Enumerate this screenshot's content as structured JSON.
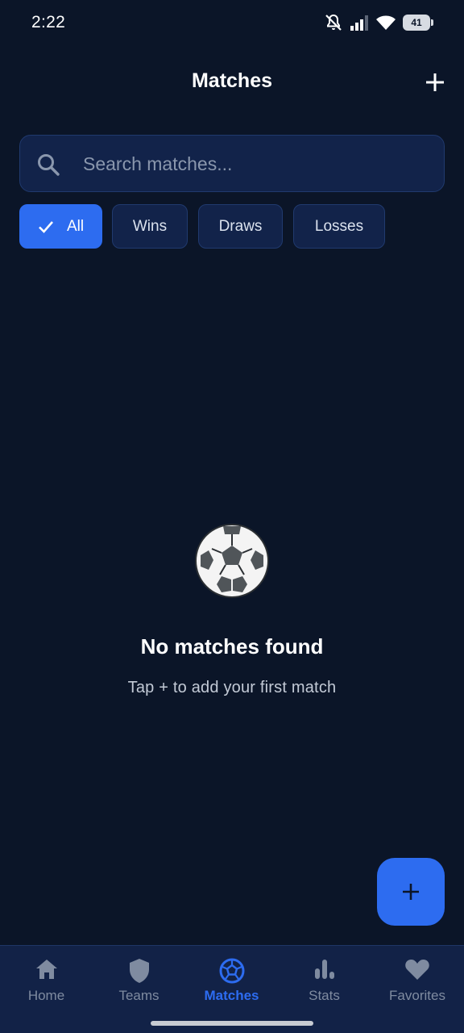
{
  "status_bar": {
    "time": "2:22",
    "battery_level": "41",
    "icons": [
      "notifications-off-icon",
      "signal-icon",
      "wifi-icon",
      "battery-icon"
    ]
  },
  "app_bar": {
    "title": "Matches",
    "action_icon": "plus-icon"
  },
  "search": {
    "placeholder": "Search matches...",
    "value": ""
  },
  "filters": [
    {
      "label": "All",
      "selected": true,
      "icon": "check-icon"
    },
    {
      "label": "Wins",
      "selected": false
    },
    {
      "label": "Draws",
      "selected": false
    },
    {
      "label": "Losses",
      "selected": false
    }
  ],
  "empty_state": {
    "icon": "soccer-ball-icon",
    "title": "No matches found",
    "subtitle": "Tap + to add your first match"
  },
  "fab": {
    "icon": "plus-icon"
  },
  "bottom_nav": {
    "items": [
      {
        "label": "Home",
        "icon": "home-icon",
        "active": false
      },
      {
        "label": "Teams",
        "icon": "shield-icon",
        "active": false
      },
      {
        "label": "Matches",
        "icon": "soccer-ball-icon",
        "active": true
      },
      {
        "label": "Stats",
        "icon": "bar-chart-icon",
        "active": false
      },
      {
        "label": "Favorites",
        "icon": "heart-icon",
        "active": false
      }
    ]
  },
  "colors": {
    "background": "#0b1528",
    "surface": "#12234a",
    "accent": "#2d6cf0",
    "inactive": "#7f8ba0"
  }
}
